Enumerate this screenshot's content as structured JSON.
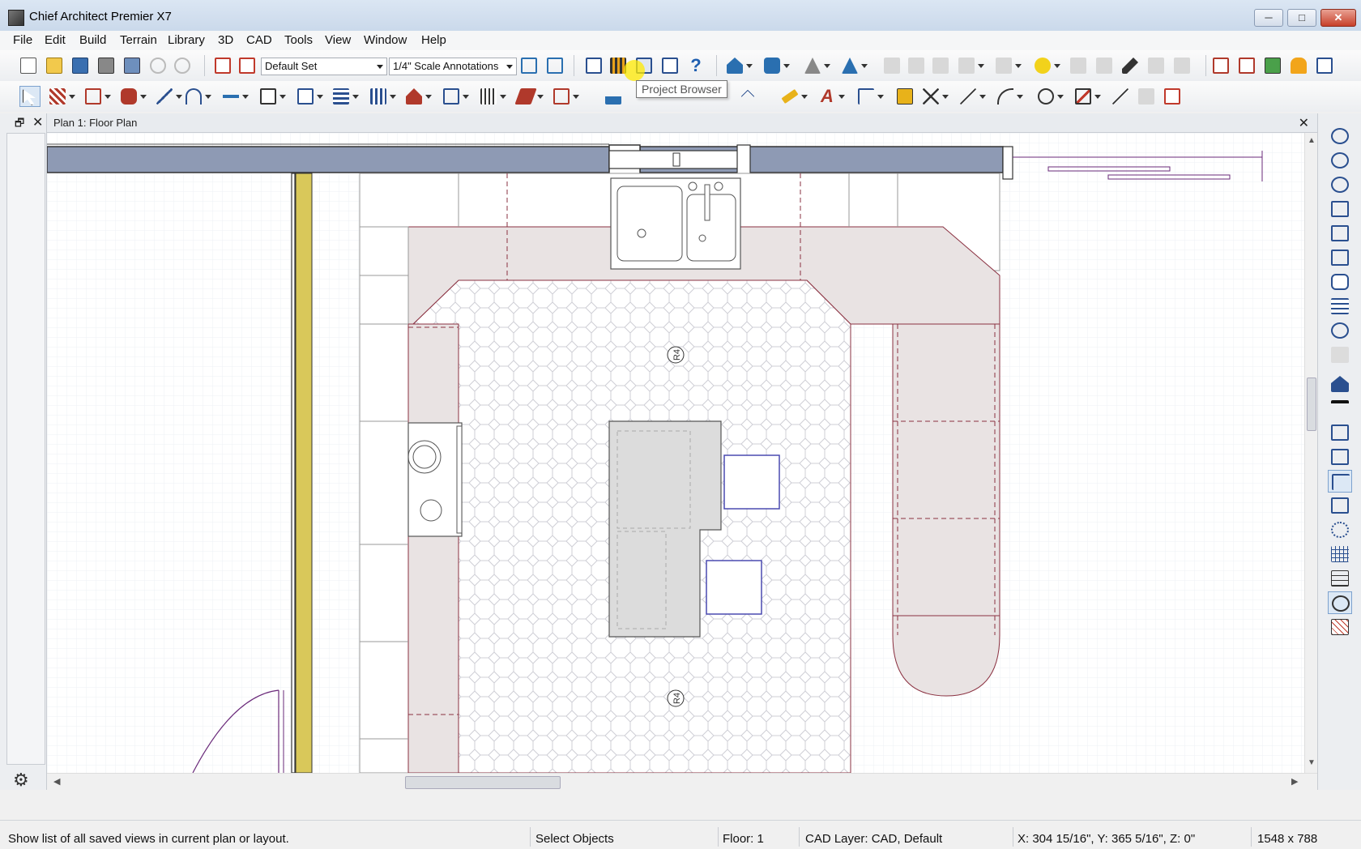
{
  "window": {
    "title": "Chief Architect Premier X7",
    "controls": {
      "minimize": "─",
      "maximize": "□",
      "close": "✕"
    }
  },
  "menu": [
    "File",
    "Edit",
    "Build",
    "Terrain",
    "Library",
    "3D",
    "CAD",
    "Tools",
    "View",
    "Window",
    "Help"
  ],
  "toolbar": {
    "layer_set": "Default Set",
    "annotation_set": "1/4\" Scale Annotations",
    "tooltip": "Project Browser",
    "help_glyph": "?"
  },
  "document": {
    "tab_label": "Plan 1: Floor Plan",
    "close_glyph": "✕",
    "float_glyph": "🗗"
  },
  "plan": {
    "room_labels": [
      "R4",
      "R4"
    ]
  },
  "statusbar": {
    "hint": "Show list of all saved views in current plan or layout.",
    "mode": "Select Objects",
    "floor": "Floor: 1",
    "cad_layer": "CAD Layer: CAD,  Default",
    "coords": "X: 304 15/16\", Y: 365 5/16\", Z: 0\"",
    "size": "1548 x 788"
  },
  "colors": {
    "wall_fill": "#8e9ab4",
    "partition_yellow": "#d9c85a",
    "counter_fill": "#e9e3e3",
    "cabinet_line": "#8a3040",
    "accent_purple": "#6a2a7a",
    "stool_blue": "#4a4ab0"
  },
  "icons": {
    "gear": "⚙",
    "scroll_left": "◀",
    "scroll_right": "▶",
    "scroll_up": "▲",
    "scroll_down": "▼"
  }
}
